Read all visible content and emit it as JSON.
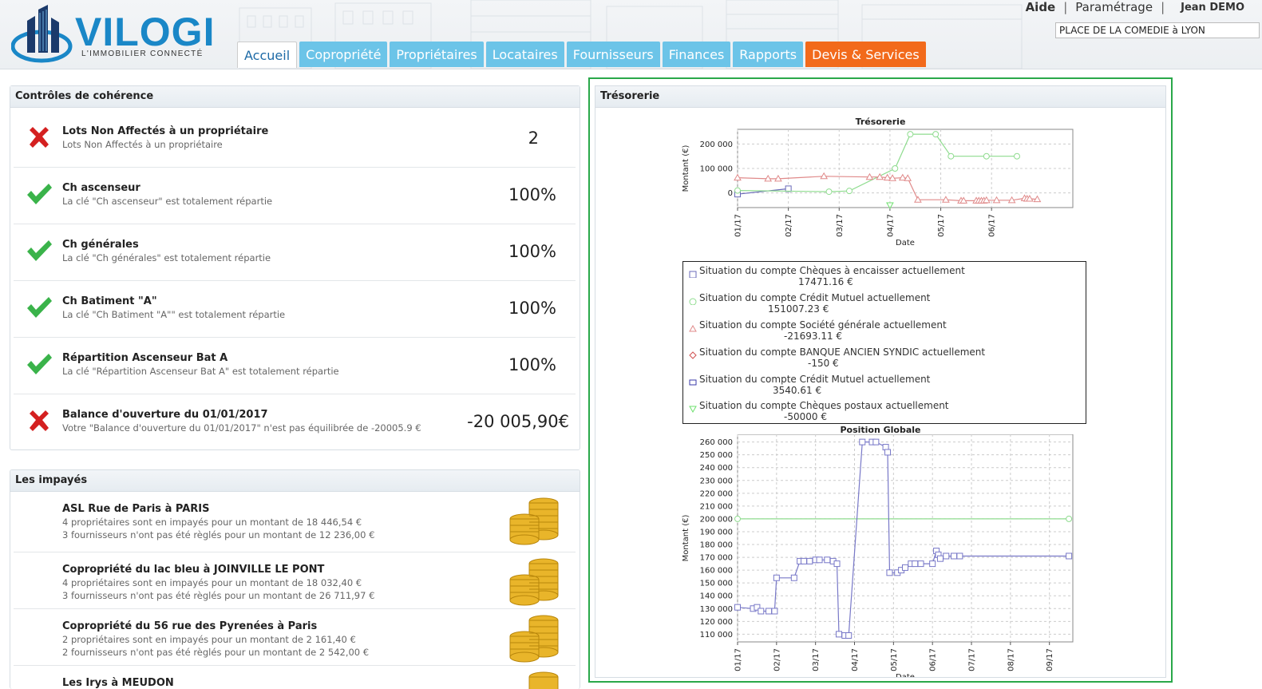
{
  "brand": {
    "name": "VILOGI",
    "tagline": "L'IMMOBILIER CONNECTÉ"
  },
  "header": {
    "help": "Aide",
    "settings": "Paramétrage",
    "user": "Jean DEMO",
    "site_value": "PLACE DE LA COMEDIE à LYON"
  },
  "tabs": [
    "Accueil",
    "Copropriété",
    "Propriétaires",
    "Locataires",
    "Fournisseurs",
    "Finances",
    "Rapports",
    "Devis & Services"
  ],
  "coherence": {
    "title": "Contrôles de cohérence",
    "items": [
      {
        "status": "error",
        "title": "Lots Non Affectés à un propriétaire",
        "desc": "Lots Non Affectés à un propriétaire",
        "value": "2"
      },
      {
        "status": "ok",
        "title": "Ch ascenseur",
        "desc": "La clé \"Ch ascenseur\" est totalement répartie",
        "value": "100%"
      },
      {
        "status": "ok",
        "title": "Ch générales",
        "desc": "La clé \"Ch générales\" est totalement répartie",
        "value": "100%"
      },
      {
        "status": "ok",
        "title": "Ch Batiment \"A\"",
        "desc": "La clé \"Ch Batiment \"A\"\" est totalement répartie",
        "value": "100%"
      },
      {
        "status": "ok",
        "title": "Répartition Ascenseur Bat A",
        "desc": "La clé \"Répartition Ascenseur Bat A\" est totalement répartie",
        "value": "100%"
      },
      {
        "status": "error",
        "title": "Balance d'ouverture du 01/01/2017",
        "desc": "Votre \"Balance d'ouverture du 01/01/2017\" n'est pas équilibrée de -20005.9 €",
        "value": "-20 005,90€"
      }
    ]
  },
  "impayes": {
    "title": "Les impayés",
    "items": [
      {
        "title": "ASL Rue de Paris à PARIS",
        "line1": "4 propriétaires sont en impayés pour un montant de 18 446,54 €",
        "line2": "3 fournisseurs n'ont pas été règlés pour un montant de 12 236,00 €"
      },
      {
        "title": "Copropriété du lac bleu à JOINVILLE LE PONT",
        "line1": "4 propriétaires sont en impayés pour un montant de 18 032,40 €",
        "line2": "3 fournisseurs n'ont pas été règlés pour un montant de 26 711,97 €"
      },
      {
        "title": "Copropriété du 56 rue des Pyrenées à Paris",
        "line1": "2 propriétaires sont en impayés pour un montant de 2 161,40 €",
        "line2": "2 fournisseurs n'ont pas été règlés pour un montant de 2 542,00 €"
      },
      {
        "title": "Les Irys à MEUDON",
        "line1": "",
        "line2": ""
      }
    ]
  },
  "tresorerie": {
    "title": "Trésorerie",
    "legend": [
      {
        "marker": "square",
        "color": "#6a6ab8",
        "label": "Situation du compte Chèques à encaisser actuellement",
        "amount": "17471.16 €"
      },
      {
        "marker": "circle",
        "color": "#8fdc8f",
        "label": "Situation du compte Crédit Mutuel actuellement",
        "amount": "151007.23 €"
      },
      {
        "marker": "triangle",
        "color": "#e08a8a",
        "label": "Situation du compte Société générale actuellement",
        "amount": "-21693.11 €"
      },
      {
        "marker": "diamond",
        "color": "#d05050",
        "label": "Situation du compte BANQUE ANCIEN SYNDIC actuellement",
        "amount": "-150 €"
      },
      {
        "marker": "square",
        "color": "#3a3aa8",
        "label": "Situation du compte Crédit Mutuel actuellement",
        "amount": "3540.61 €"
      },
      {
        "marker": "triangle-down",
        "color": "#6ee06e",
        "label": "Situation du compte Chèques postaux actuellement",
        "amount": "-50000 €"
      }
    ]
  },
  "chart_data": [
    {
      "type": "line",
      "title": "Trésorerie",
      "xlabel": "Date",
      "ylabel": "Montant (€)",
      "x_ticks": [
        "01/17",
        "02/17",
        "03/17",
        "04/17",
        "05/17",
        "06/17"
      ],
      "y_ticks": [
        0,
        100000,
        200000
      ],
      "y_tick_labels": [
        "0",
        "100 000",
        "200 000"
      ],
      "ylim": [
        -60000,
        260000
      ],
      "xlim": [
        0,
        6.6
      ],
      "grid": true,
      "series": [
        {
          "color": "#6a6ab8",
          "marker": "square",
          "points": [
            [
              0.0,
              -5000
            ],
            [
              1.0,
              17000
            ]
          ]
        },
        {
          "color": "#8fdc8f",
          "marker": "circle",
          "points": [
            [
              0.0,
              10000
            ],
            [
              1.8,
              5000
            ],
            [
              2.2,
              8000
            ],
            [
              3.1,
              100000
            ],
            [
              3.4,
              240000
            ],
            [
              3.9,
              240000
            ],
            [
              4.2,
              150000
            ],
            [
              4.9,
              150000
            ],
            [
              5.5,
              150000
            ]
          ]
        },
        {
          "color": "#e08a8a",
          "marker": "triangle",
          "points": [
            [
              0.0,
              62000
            ],
            [
              0.6,
              58000
            ],
            [
              0.8,
              58000
            ],
            [
              1.7,
              68000
            ],
            [
              2.6,
              65000
            ],
            [
              2.8,
              65000
            ],
            [
              2.95,
              62000
            ],
            [
              3.05,
              60000
            ],
            [
              3.25,
              62000
            ],
            [
              3.35,
              60000
            ],
            [
              3.55,
              -28000
            ],
            [
              4.1,
              -28000
            ],
            [
              4.4,
              -32000
            ],
            [
              4.45,
              -32000
            ],
            [
              4.7,
              -32000
            ],
            [
              4.75,
              -32000
            ],
            [
              4.8,
              -32000
            ],
            [
              4.85,
              -32000
            ],
            [
              4.9,
              -30000
            ],
            [
              5.1,
              -30000
            ],
            [
              5.4,
              -30000
            ],
            [
              5.65,
              -22000
            ],
            [
              5.7,
              -24000
            ],
            [
              5.75,
              -24000
            ],
            [
              5.9,
              -26000
            ]
          ]
        },
        {
          "color": "#6ee06e",
          "marker": "triangle-down",
          "points": [
            [
              3.0,
              -50000
            ]
          ]
        }
      ]
    },
    {
      "type": "line",
      "title": "Position Globale",
      "xlabel": "Date",
      "ylabel": "Montant (€)",
      "x_ticks": [
        "01/17",
        "02/17",
        "03/17",
        "04/17",
        "05/17",
        "06/17",
        "07/17",
        "08/17",
        "09/17"
      ],
      "y_ticks": [
        110000,
        120000,
        130000,
        140000,
        150000,
        160000,
        170000,
        180000,
        190000,
        200000,
        210000,
        220000,
        230000,
        240000,
        250000,
        260000
      ],
      "y_tick_labels": [
        "110 000",
        "120 000",
        "130 000",
        "140 000",
        "150 000",
        "160 000",
        "170 000",
        "180 000",
        "190 000",
        "200 000",
        "210 000",
        "220 000",
        "230 000",
        "240 000",
        "250 000",
        "260 000"
      ],
      "ylim": [
        104000,
        266000
      ],
      "xlim": [
        0,
        8.6
      ],
      "grid": true,
      "series": [
        {
          "color": "#8fdc8f",
          "marker": "circle",
          "points": [
            [
              0.0,
              200000
            ],
            [
              8.5,
              200000
            ]
          ]
        },
        {
          "color": "#7878c8",
          "marker": "square",
          "points": [
            [
              0.0,
              131000
            ],
            [
              0.4,
              130000
            ],
            [
              0.5,
              131000
            ],
            [
              0.6,
              128000
            ],
            [
              0.8,
              128000
            ],
            [
              0.95,
              128000
            ],
            [
              1.0,
              154000
            ],
            [
              1.45,
              154000
            ],
            [
              1.6,
              167000
            ],
            [
              1.7,
              167000
            ],
            [
              1.85,
              167000
            ],
            [
              2.0,
              168000
            ],
            [
              2.1,
              168000
            ],
            [
              2.3,
              168000
            ],
            [
              2.45,
              167000
            ],
            [
              2.55,
              165000
            ],
            [
              2.6,
              110000
            ],
            [
              2.75,
              109000
            ],
            [
              2.85,
              109000
            ],
            [
              3.2,
              260000
            ],
            [
              3.45,
              260000
            ],
            [
              3.55,
              260000
            ],
            [
              3.8,
              256000
            ],
            [
              3.85,
              252000
            ],
            [
              3.9,
              158000
            ],
            [
              4.1,
              158000
            ],
            [
              4.2,
              160000
            ],
            [
              4.3,
              162000
            ],
            [
              4.45,
              165000
            ],
            [
              4.55,
              165000
            ],
            [
              4.7,
              165000
            ],
            [
              5.0,
              165000
            ],
            [
              5.1,
              175000
            ],
            [
              5.15,
              172000
            ],
            [
              5.2,
              169000
            ],
            [
              5.35,
              171000
            ],
            [
              5.55,
              171000
            ],
            [
              5.7,
              171000
            ],
            [
              8.5,
              171000
            ]
          ]
        }
      ]
    }
  ]
}
